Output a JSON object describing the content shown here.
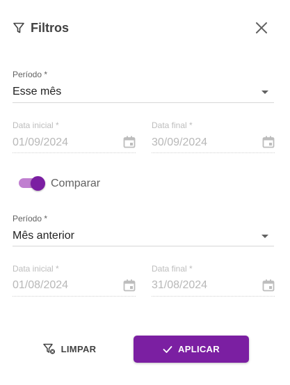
{
  "header": {
    "title": "Filtros",
    "icon": "filter-icon",
    "close_icon": "close-icon"
  },
  "period1": {
    "label": "Período *",
    "value": "Esse mês",
    "start_label": "Data inicial *",
    "start_value": "01/09/2024",
    "end_label": "Data final *",
    "end_value": "30/09/2024"
  },
  "compare": {
    "label": "Comparar",
    "enabled": true
  },
  "period2": {
    "label": "Período *",
    "value": "Mês anterior",
    "start_label": "Data inicial *",
    "start_value": "01/08/2024",
    "end_label": "Data final *",
    "end_value": "31/08/2024"
  },
  "actions": {
    "clear_label": "LIMPAR",
    "clear_icon": "filter-clear-icon",
    "apply_label": "APLICAR",
    "apply_icon": "check-icon"
  },
  "colors": {
    "accent": "#7b1fa2",
    "toggle_track": "#c07fd0"
  }
}
